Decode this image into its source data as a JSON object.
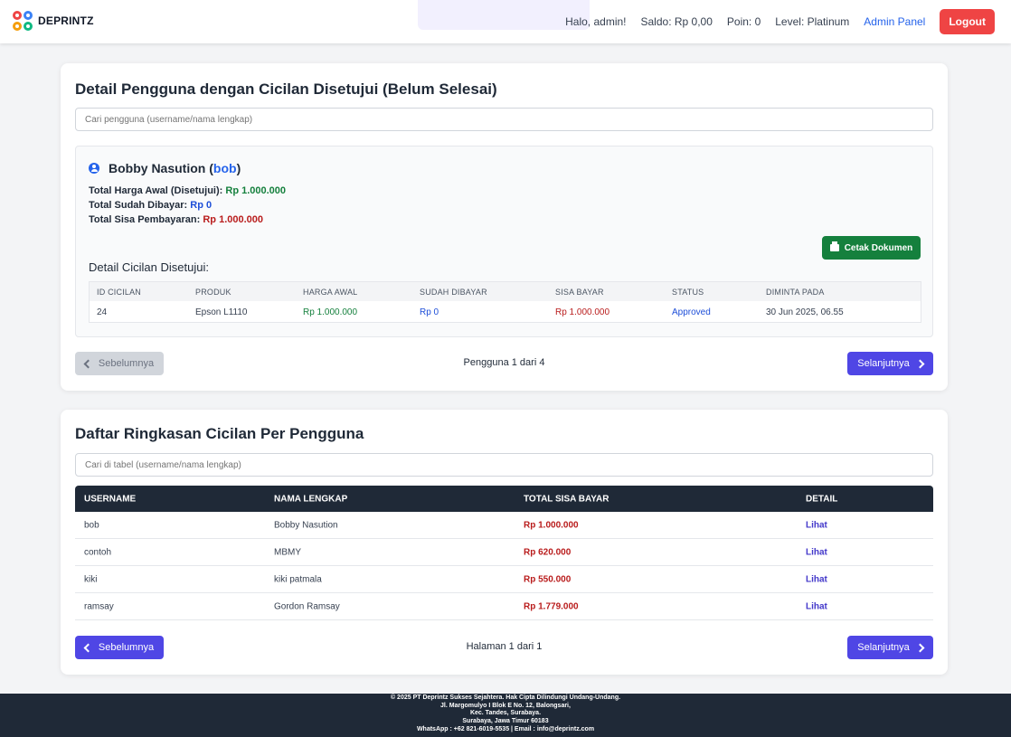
{
  "header": {
    "brand": "DEPRINTZ",
    "greeting": "Halo, admin!",
    "saldo": "Saldo: Rp 0,00",
    "poin": "Poin: 0",
    "level": "Level: Platinum",
    "admin_panel": "Admin Panel",
    "logout": "Logout"
  },
  "approved": {
    "title": "Detail Pengguna dengan Cicilan Disetujui (Belum Selesai)",
    "search_placeholder": "Cari pengguna (username/nama lengkap)",
    "user": {
      "full_name": "Bobby Nasution",
      "open_paren": "(",
      "username": "bob",
      "close_paren": ")",
      "total_awal_label": "Total Harga Awal (Disetujui):",
      "total_awal_value": "Rp 1.000.000",
      "total_dibayar_label": "Total Sudah Dibayar:",
      "total_dibayar_value": "Rp 0",
      "total_sisa_label": "Total Sisa Pembayaran:",
      "total_sisa_value": "Rp 1.000.000"
    },
    "print_button": "Cetak Dokumen",
    "detail_title": "Detail Cicilan Disetujui:",
    "table": {
      "headers": [
        "ID CICILAN",
        "PRODUK",
        "HARGA AWAL",
        "SUDAH DIBAYAR",
        "SISA BAYAR",
        "STATUS",
        "DIMINTA PADA"
      ],
      "rows": [
        [
          "24",
          "Epson L1110",
          "Rp 1.000.000",
          "Rp 0",
          "Rp 1.000.000",
          "Approved",
          "30 Jun 2025, 06.55"
        ]
      ]
    },
    "pager": {
      "prev": "Sebelumnya",
      "info": "Pengguna 1 dari 4",
      "next": "Selanjutnya"
    }
  },
  "summary": {
    "title": "Daftar Ringkasan Cicilan Per Pengguna",
    "search_placeholder": "Cari di tabel (username/nama lengkap)",
    "headers": [
      "USERNAME",
      "NAMA LENGKAP",
      "TOTAL SISA BAYAR",
      "DETAIL"
    ],
    "rows": [
      [
        "bob",
        "Bobby Nasution",
        "Rp 1.000.000",
        "Lihat"
      ],
      [
        "contoh",
        "MBMY",
        "Rp 620.000",
        "Lihat"
      ],
      [
        "kiki",
        "kiki patmala",
        "Rp 550.000",
        "Lihat"
      ],
      [
        "ramsay",
        "Gordon Ramsay",
        "Rp 1.779.000",
        "Lihat"
      ]
    ],
    "pager": {
      "prev": "Sebelumnya",
      "info": "Halaman 1 dari 1",
      "next": "Selanjutnya"
    }
  },
  "footer": {
    "line1": "© 2025 PT Deprintz Sukses Sejahtera. Hak Cipta Dilindungi Undang-Undang.",
    "line2": "Jl. Margomulyo I Blok E No. 12, Balongsari,",
    "line3": "Kec. Tandes, Surabaya.",
    "line4": "Surabaya, Jawa Timur 60183",
    "line5": "WhatsApp : +62 821-6019-5535 | Email : info@deprintz.com"
  }
}
